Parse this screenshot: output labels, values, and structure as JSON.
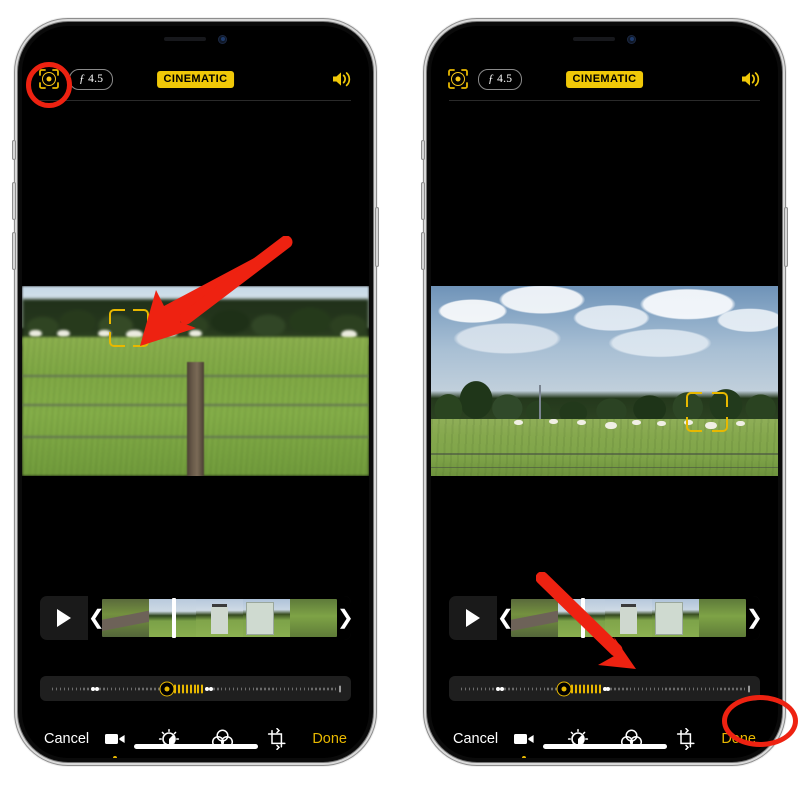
{
  "screenshot": {
    "title": "iPhone Cinematic mode video editing — focus point adjustment",
    "panels": 2
  },
  "colors": {
    "accent_yellow": "#e8b800",
    "badge_yellow": "#f0c808",
    "annotation_red": "#ee2211",
    "screen_black": "#000000",
    "frame_silver": "#d9d9d9"
  },
  "left_panel": {
    "name": "step-1-tap-cinematic-button",
    "topbar": {
      "cinematic_toggle_icon": "cinematic-focus-icon",
      "aperture_label": "4.5",
      "aperture_prefix": "ƒ",
      "mode_badge": "CINEMATIC",
      "speaker_icon": "speaker-on-icon"
    },
    "photo": {
      "description": "Blurred close-up of fenced green field with wooden post, sheep and treeline behind",
      "focus_box_label": "focus-bracket"
    },
    "filmstrip": {
      "play_icon": "play-icon",
      "left_handle": "❮",
      "right_handle": "❯",
      "frames": 5,
      "playhead_position_pct": 32
    },
    "depth_slider": {
      "label": "depth-of-field-slider",
      "thumb_position_pct": 40,
      "range_start_pct": 14,
      "range_end_pct": 54
    },
    "toolbar": {
      "cancel_label": "Cancel",
      "done_label": "Done",
      "tools": [
        {
          "name": "video-trim-tool-icon",
          "active": true
        },
        {
          "name": "adjust-exposure-tool-icon",
          "active": false
        },
        {
          "name": "filters-tool-icon",
          "active": false
        },
        {
          "name": "crop-rotate-tool-icon",
          "active": false
        }
      ]
    },
    "annotations": {
      "circle_target": "cinematic-focus-icon",
      "arrow_target": "focus-bracket-on-sheep",
      "arrow_direction": "down-left"
    }
  },
  "right_panel": {
    "name": "step-2-tap-done-to-save",
    "topbar": {
      "cinematic_toggle_icon": "cinematic-focus-icon",
      "aperture_label": "4.5",
      "aperture_prefix": "ƒ",
      "mode_badge": "CINEMATIC",
      "speaker_icon": "speaker-on-icon"
    },
    "photo": {
      "description": "Wide landscape of cloudy sky over treeline and sheep grazing in a green field",
      "focus_box_label": "focus-bracket"
    },
    "filmstrip": {
      "play_icon": "play-icon",
      "left_handle": "❮",
      "right_handle": "❯",
      "frames": 5,
      "playhead_position_pct": 32
    },
    "depth_slider": {
      "label": "depth-of-field-slider",
      "thumb_position_pct": 36,
      "range_start_pct": 13,
      "range_end_pct": 50
    },
    "toolbar": {
      "cancel_label": "Cancel",
      "done_label": "Done",
      "tools": [
        {
          "name": "video-trim-tool-icon",
          "active": true
        },
        {
          "name": "adjust-exposure-tool-icon",
          "active": false
        },
        {
          "name": "filters-tool-icon",
          "active": false
        },
        {
          "name": "crop-rotate-tool-icon",
          "active": false
        }
      ]
    },
    "annotations": {
      "circle_target": "done-button",
      "arrow_target": "depth-slider-thumb",
      "arrow_direction": "down-right"
    }
  }
}
